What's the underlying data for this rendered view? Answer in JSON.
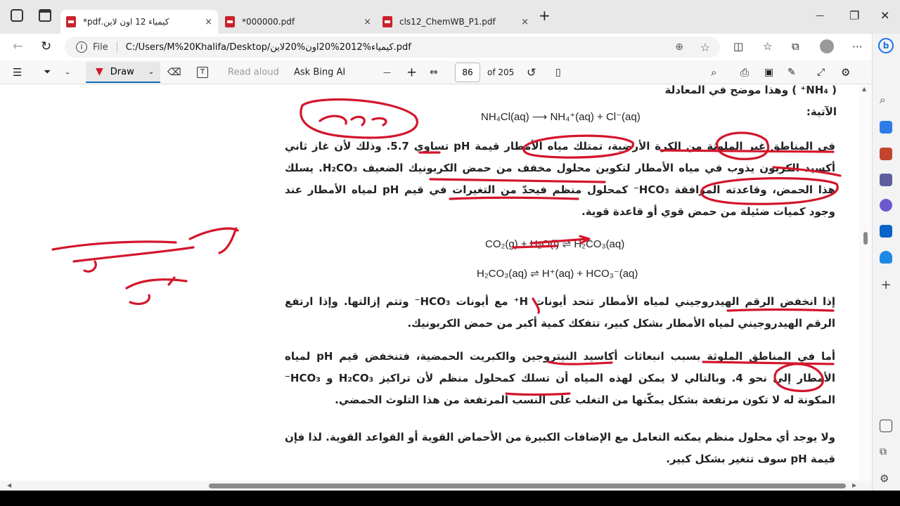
{
  "tabs": [
    {
      "title": "كيمياء 12 اون لاين.pdf*",
      "close": "×"
    },
    {
      "title": "*000000.pdf",
      "close": "×"
    },
    {
      "title": "cls12_ChemWB_P1.pdf",
      "close": "×"
    }
  ],
  "new_tab": "+",
  "window_controls": {
    "minimize": "—",
    "restore": "❐",
    "close": "✕"
  },
  "address": {
    "protocol_label": "File",
    "url": "C:/Users/M%20Khalifa/Desktop/كيمياء%2012%20اون%20لاين.pdf"
  },
  "pdf_toolbar": {
    "draw_label": "Draw",
    "read_aloud": "Read aloud",
    "ask_bing": "Ask Bing AI",
    "zoom_out": "—",
    "zoom_in": "+",
    "page_number": "86",
    "page_total": "of 205"
  },
  "document": {
    "top_partial": "( NH₄⁺ ) وهذا موضح في المعادلة الآتية:",
    "eq1": "NH₄Cl(aq) ⟶ NH₄⁺(aq) + Cl⁻(aq)",
    "para1": "في المناطق غير الملوثة من الكرة الأرضية، تمتلك مياه الأمطار قيمة pH تساوي 5.7. وذلك لأن غاز ثاني أكسيد الكربون يذوب في مياه الأمطار لتكوين محلول مخفف من حمض الكربونيك الضعيف H₂CO₃. يسلك هذا الحمض، وقاعدته المرافقة HCO₃⁻ كمحلول منظم فيحدّ من التغيرات في قيم pH لمياه الأمطار عند وجود كميات ضئيلة من حمض قوي أو قاعدة قوية.",
    "eq2": "CO₂(g) + H₂O(l) ⇌ H₂CO₃(aq)",
    "eq3": "H₂CO₃(aq) ⇌ H⁺(aq) + HCO₃⁻(aq)",
    "para2": "إذا انخفض الرقم الهيدروجيني لمياه الأمطار تتحد أيونات H⁺ مع أيونات HCO₃⁻ وتتم إزالتها. وإذا ارتفع الرقم الهيدروجيني لمياه الأمطار بشكل كبير، تتفكك كمية أكبر من حمض الكربونيك.",
    "para3": "أما في المناطق الملوثة بسبب انبعاثات أكاسيد النيتروجين والكبريت الحمضية، فتنخفض قيم pH لمياه الأمطار إلى نحو 4. وبالتالي لا يمكن لهذه المياه أن تسلك كمحلول منظم لأن تراكيز H₂CO₃ و HCO₃⁻ المكونة له لا تكون مرتفعة بشكل يمكّنها من التغلب على النسب المرتفعة من هذا التلوث الحمضي.",
    "para4": "ولا يوجد أي محلول منظم يمكنه التعامل مع الإضافات الكبيرة من الأحماض القوية أو القواعد القوية. لذا فإن قيمة pH سوف تتغير بشكل كبير."
  },
  "ink_color": "#d3162b"
}
